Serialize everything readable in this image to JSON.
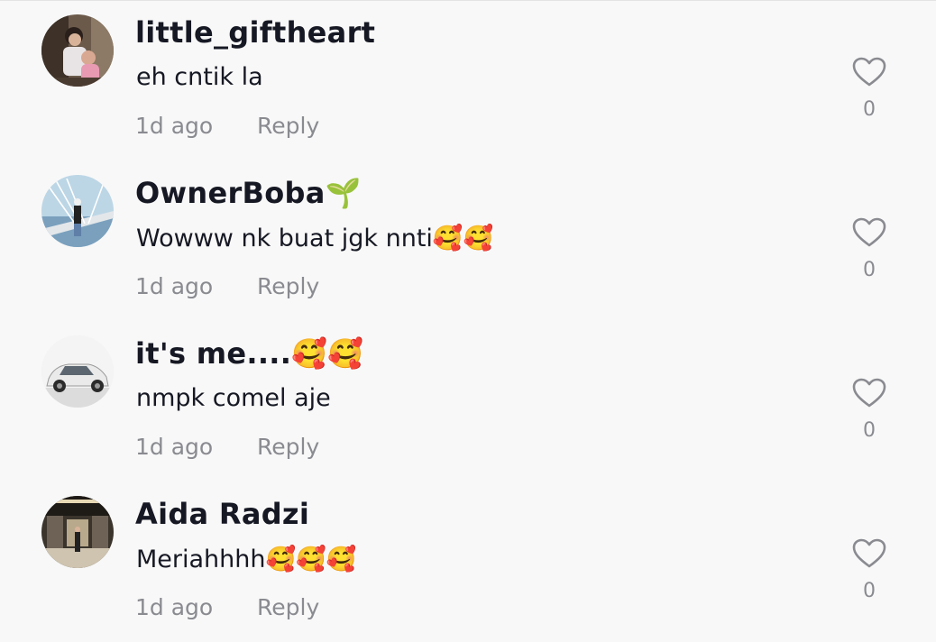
{
  "comments": [
    {
      "username": "little_giftheart",
      "text": "eh cntik la",
      "time": "1d ago",
      "reply_label": "Reply",
      "likes": "0",
      "avatar_icon": "child-photo-avatar"
    },
    {
      "username": "OwnerBoba🌱",
      "text": "Wowww nk buat jgk nnti🥰🥰",
      "time": "1d ago",
      "reply_label": "Reply",
      "likes": "0",
      "avatar_icon": "bridge-photo-avatar"
    },
    {
      "username": "it's me....🥰🥰",
      "text": "nmpk comel aje",
      "time": "1d ago",
      "reply_label": "Reply",
      "likes": "0",
      "avatar_icon": "car-photo-avatar"
    },
    {
      "username": "Aida Radzi",
      "text": "Meriahhhh🥰🥰🥰",
      "time": "1d ago",
      "reply_label": "Reply",
      "likes": "0",
      "avatar_icon": "mall-photo-avatar"
    }
  ],
  "colors": {
    "background": "#f8f8f8",
    "username": "#161823",
    "meta": "#8a8b91",
    "heart_outline": "#8a8b91"
  }
}
